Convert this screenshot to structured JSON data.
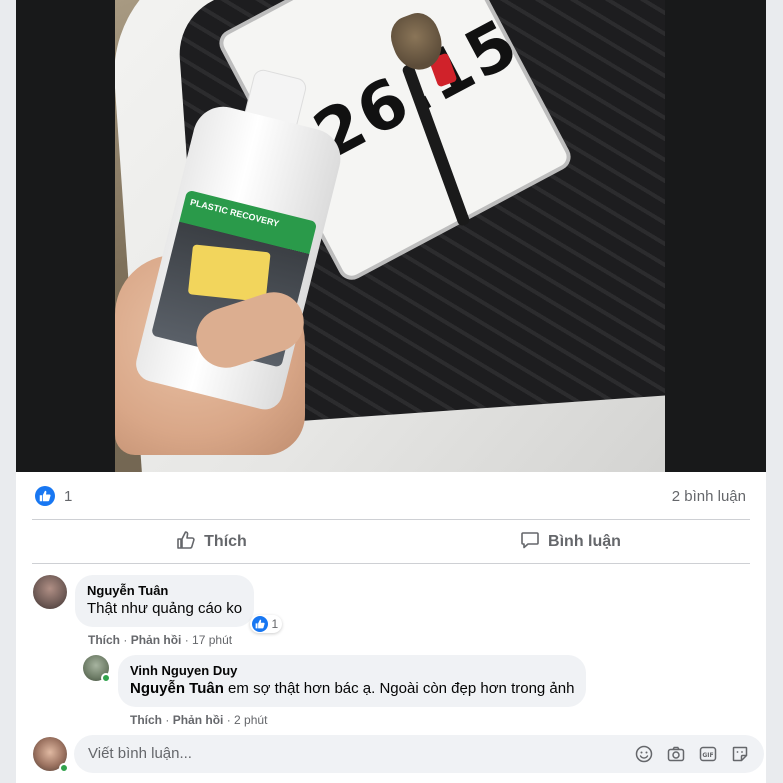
{
  "post": {
    "photo": {
      "plate_text": "326.15",
      "bottle_label_text": "PLASTIC RECOVERY"
    },
    "stats": {
      "like_count": "1",
      "comment_count": "2 bình luận"
    },
    "actions": {
      "like_label": "Thích",
      "comment_label": "Bình luận"
    }
  },
  "comments": [
    {
      "author": "Nguyễn Tuân",
      "text": "Thật như quảng cáo ko",
      "reaction_count": "1",
      "like_label": "Thích",
      "reply_label": "Phản hồi",
      "time": "17 phút"
    },
    {
      "author": "Vinh Nguyen Duy",
      "mention": "Nguyễn Tuân",
      "text": " em sợ thật hơn bác ạ. Ngoài còn đẹp hơn trong ảnh",
      "like_label": "Thích",
      "reply_label": "Phản hồi",
      "time": "2 phút"
    }
  ],
  "composer": {
    "placeholder": "Viết bình luận...",
    "icons": [
      "emoji-icon",
      "camera-icon",
      "gif-icon",
      "sticker-icon"
    ]
  },
  "colors": {
    "accent": "#1877f2",
    "text_secondary": "#65676b",
    "bubble": "#f0f2f5",
    "online": "#31a24c"
  }
}
